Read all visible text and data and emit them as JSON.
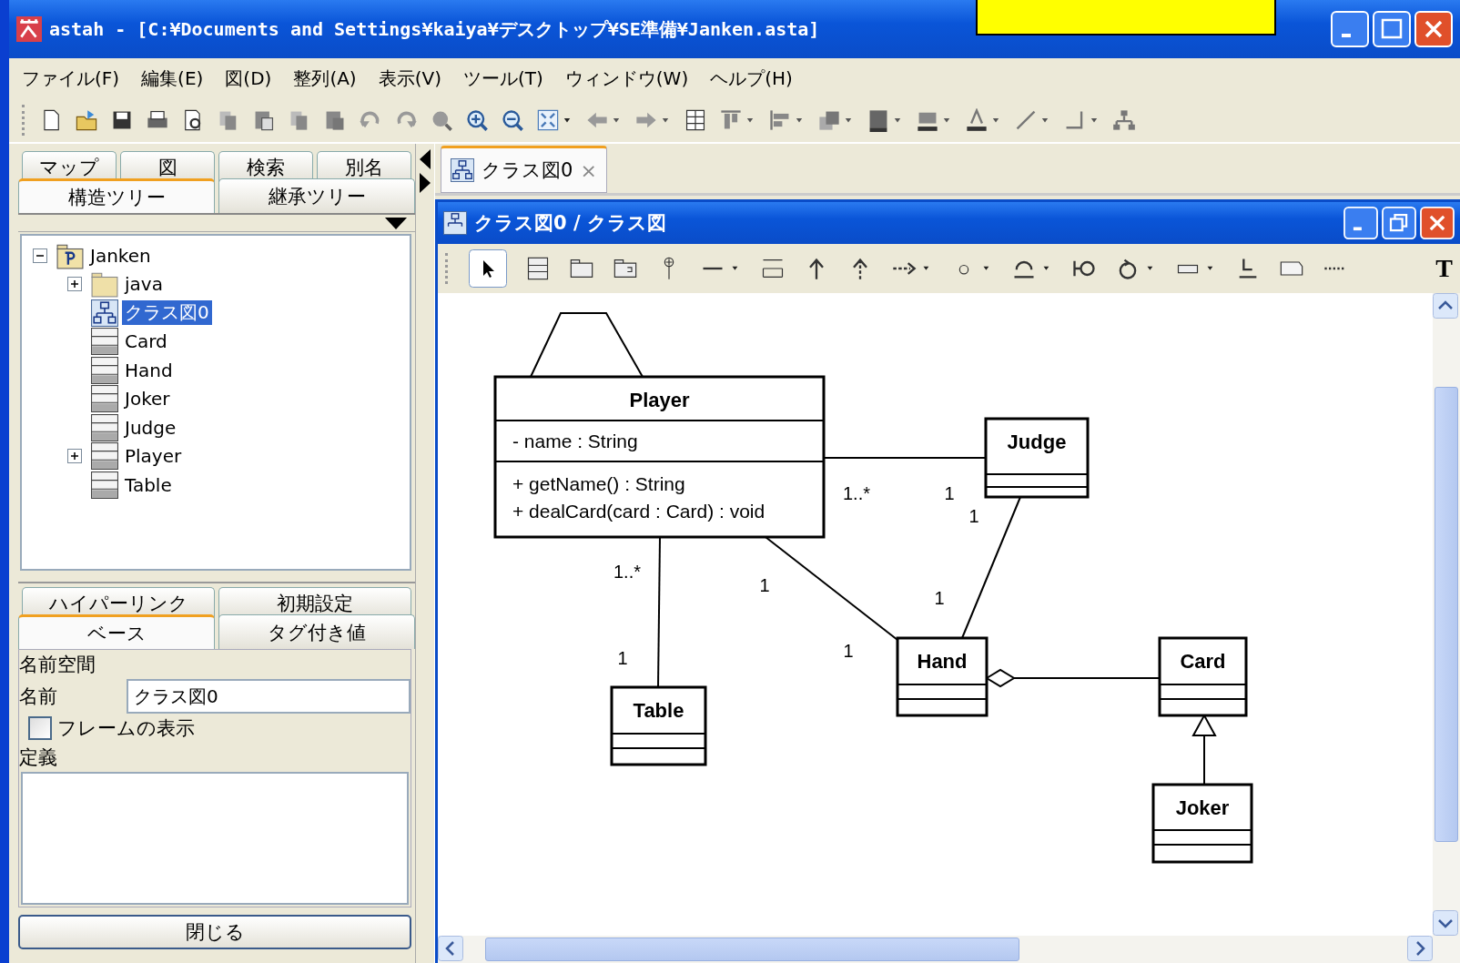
{
  "window": {
    "title": "astah - [C:¥Documents and Settings¥kaiya¥デスクトップ¥SE準備¥Janken.asta]"
  },
  "menu": [
    "ファイル(F)",
    "編集(E)",
    "図(D)",
    "整列(A)",
    "表示(V)",
    "ツール(T)",
    "ウィンドウ(W)",
    "ヘルプ(H)"
  ],
  "sidebar": {
    "tab_rows": [
      [
        {
          "label": "マップ",
          "selected": false
        },
        {
          "label": "図",
          "selected": false
        },
        {
          "label": "検索",
          "selected": false
        },
        {
          "label": "別名",
          "selected": false
        }
      ],
      [
        {
          "label": "構造ツリー",
          "selected": true
        },
        {
          "label": "継承ツリー",
          "selected": false
        }
      ]
    ],
    "tree": [
      {
        "label": "Janken",
        "kind": "package",
        "expanded": true,
        "selected": false,
        "children": [
          {
            "label": "java",
            "kind": "folder",
            "expanded": false,
            "selected": false
          },
          {
            "label": "クラス図0",
            "kind": "diagram",
            "selected": true
          },
          {
            "label": "Card",
            "kind": "class",
            "selected": false
          },
          {
            "label": "Hand",
            "kind": "class",
            "selected": false
          },
          {
            "label": "Joker",
            "kind": "class",
            "selected": false
          },
          {
            "label": "Judge",
            "kind": "class",
            "selected": false
          },
          {
            "label": "Player",
            "kind": "class",
            "expanded": false,
            "selected": false
          },
          {
            "label": "Table",
            "kind": "class",
            "selected": false
          }
        ]
      }
    ]
  },
  "properties": {
    "tab_rows": [
      [
        {
          "label": "ハイパーリンク",
          "selected": false
        },
        {
          "label": "初期設定",
          "selected": false
        }
      ],
      [
        {
          "label": "ベース",
          "selected": true
        },
        {
          "label": "タグ付き値",
          "selected": false
        }
      ]
    ],
    "namespace_label": "名前空間",
    "name_label": "名前",
    "name_value": "クラス図0",
    "frame_checkbox": {
      "label": "フレームの表示",
      "checked": false
    },
    "definition_label": "定義",
    "close_button": "閉じる"
  },
  "editor": {
    "tabs": [
      {
        "label": "クラス図0",
        "close": "×",
        "selected": true
      }
    ],
    "window_title": "クラス図0 / クラス図",
    "text_tool": "T",
    "diagram": {
      "classes": [
        {
          "name": "Player",
          "attributes": [
            "- name : String"
          ],
          "operations": [
            "+ getName() : String",
            "+ dealCard(card : Card) : void"
          ]
        },
        {
          "name": "Judge"
        },
        {
          "name": "Hand"
        },
        {
          "name": "Card"
        },
        {
          "name": "Table"
        },
        {
          "name": "Joker"
        }
      ],
      "relations": [
        {
          "kind": "association"
        },
        {
          "kind": "association"
        },
        {
          "kind": "association"
        },
        {
          "kind": "association"
        },
        {
          "kind": "aggregation"
        },
        {
          "kind": "generalization"
        }
      ],
      "multiplicities": [
        "1..*",
        "1",
        "1",
        "1..*",
        "1",
        "1",
        "1",
        "1"
      ]
    }
  }
}
